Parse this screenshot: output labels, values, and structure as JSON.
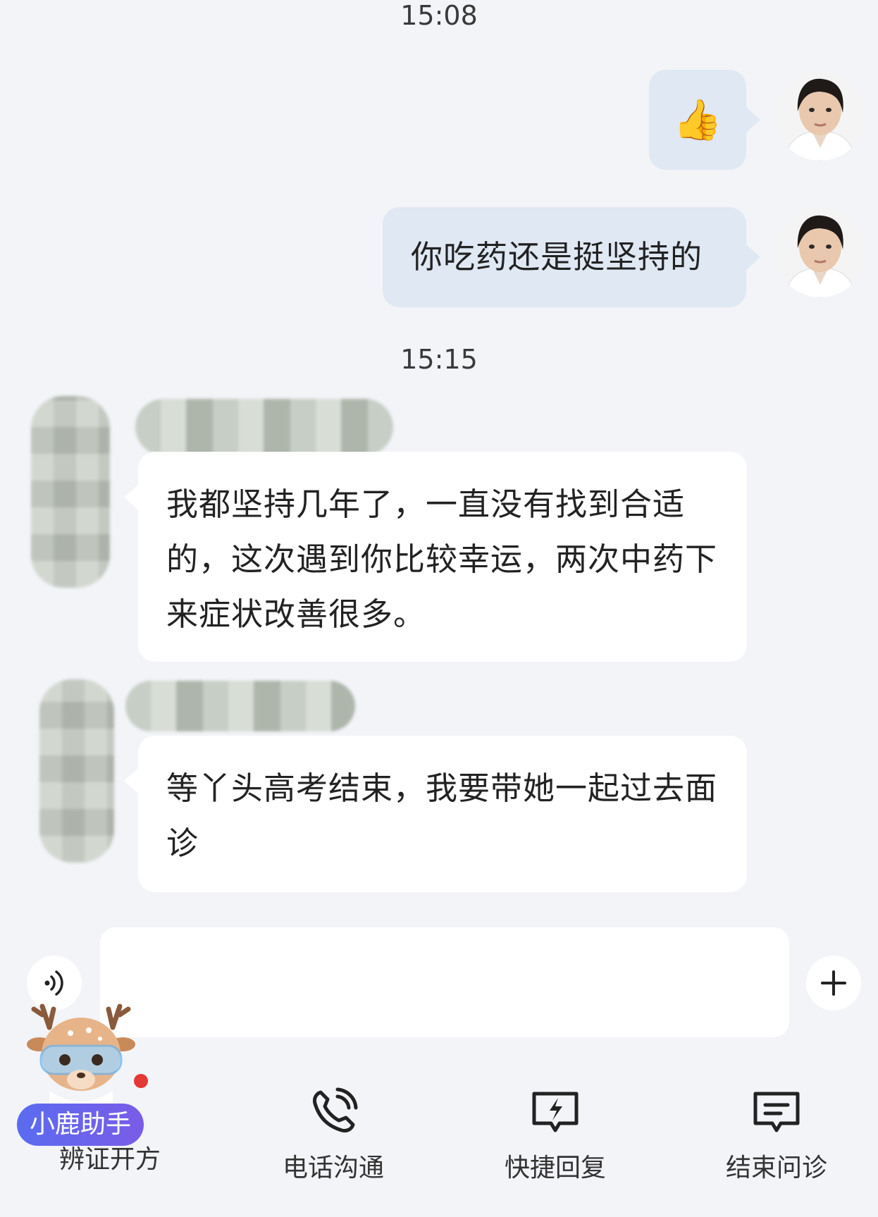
{
  "chat": {
    "timestamps": [
      "15:08",
      "15:15"
    ],
    "messages": [
      {
        "side": "out",
        "type": "emoji",
        "text": "👍"
      },
      {
        "side": "out",
        "type": "text",
        "text": "你吃药还是挺坚持的"
      },
      {
        "side": "in",
        "type": "text",
        "text": "我都坚持几年了，一直没有找到合适的，这次遇到你比较幸运，两次中药下来症状改善很多。"
      },
      {
        "side": "in",
        "type": "text",
        "text": "等丫头高考结束，我要带她一起过去面诊"
      }
    ]
  },
  "input": {
    "value": "",
    "voice_icon": "voice-icon",
    "add_icon": "plus-icon"
  },
  "assistant": {
    "label": "小鹿助手",
    "under_label": "辨证开方",
    "notification_dot": true
  },
  "toolbar": {
    "items": [
      {
        "label": "电话沟通",
        "icon": "phone-icon"
      },
      {
        "label": "快捷回复",
        "icon": "quick-reply-icon"
      },
      {
        "label": "结束问诊",
        "icon": "end-consult-icon"
      }
    ]
  },
  "colors": {
    "background": "#f3f4f8",
    "outgoing_bubble": "#dfe8f3",
    "incoming_bubble": "#ffffff",
    "assistant_badge": "#6a63ee",
    "notification": "#e53935"
  }
}
